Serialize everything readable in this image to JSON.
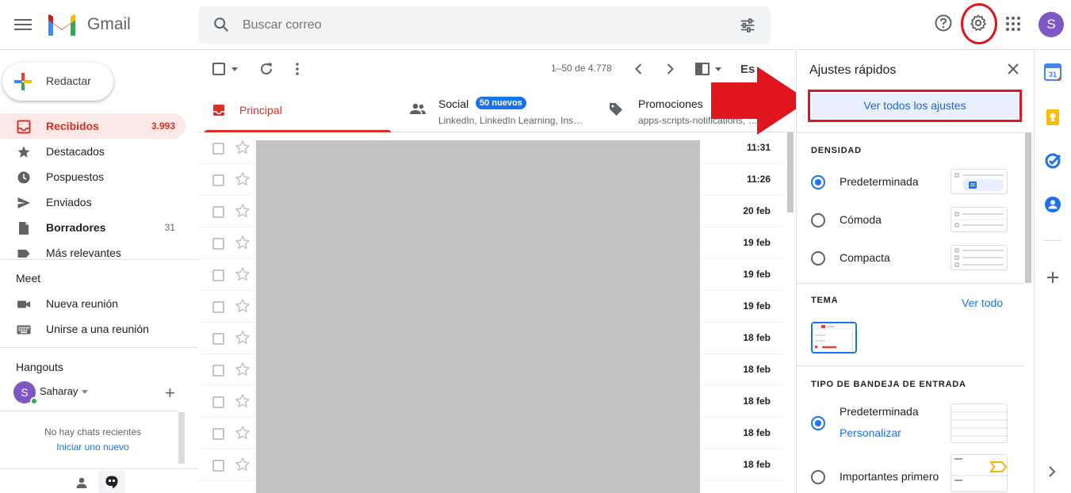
{
  "header": {
    "brand": "Gmail",
    "search_placeholder": "Buscar correo",
    "avatar_letter": "S"
  },
  "compose": {
    "label": "Redactar"
  },
  "nav": {
    "items": [
      {
        "label": "Recibidos",
        "count": "3.993"
      },
      {
        "label": "Destacados",
        "count": ""
      },
      {
        "label": "Pospuestos",
        "count": ""
      },
      {
        "label": "Enviados",
        "count": ""
      },
      {
        "label": "Borradores",
        "count": "31"
      },
      {
        "label": "Más relevantes",
        "count": ""
      }
    ]
  },
  "meet": {
    "title": "Meet",
    "items": [
      {
        "label": "Nueva reunión"
      },
      {
        "label": "Unirse a una reunión"
      }
    ]
  },
  "hangouts": {
    "title": "Hangouts",
    "user_initial": "S",
    "user_name": "Saharay",
    "no_chats": "No hay chats recientes",
    "start_new": "Iniciar uno nuevo"
  },
  "toolbar": {
    "range": "1–50 de 4.778",
    "lang": "Es"
  },
  "tabs": [
    {
      "label": "Principal",
      "sub": ""
    },
    {
      "label": "Social",
      "sub": "LinkedIn, LinkedIn Learning, Ins…",
      "badge": "50 nuevos"
    },
    {
      "label": "Promociones",
      "sub": "apps-scripts-notifications, …"
    }
  ],
  "emails": [
    {
      "date": "11:31"
    },
    {
      "date": "11:26"
    },
    {
      "date": "20 feb"
    },
    {
      "date": "19 feb"
    },
    {
      "date": "19 feb"
    },
    {
      "date": "19 feb"
    },
    {
      "date": "18 feb"
    },
    {
      "date": "18 feb"
    },
    {
      "date": "18 feb"
    },
    {
      "date": "18 feb"
    },
    {
      "date": "18 feb"
    }
  ],
  "quick_settings": {
    "title": "Ajustes rápidos",
    "see_all": "Ver todos los ajustes",
    "density": {
      "title": "DENSIDAD",
      "options": [
        "Predeterminada",
        "Cómoda",
        "Compacta"
      ],
      "selected": "Predeterminada"
    },
    "theme": {
      "title": "TEMA",
      "see_all": "Ver todo"
    },
    "inbox_type": {
      "title": "TIPO DE BANDEJA DE ENTRADA",
      "options": [
        "Predeterminada",
        "Importantes primero"
      ],
      "customize": "Personalizar",
      "selected": "Predeterminada"
    }
  },
  "colors": {
    "accent_red": "#d93025",
    "link_blue": "#1a73e8",
    "annotation_red": "#e0161e",
    "avatar_purple": "#7e57c2"
  }
}
